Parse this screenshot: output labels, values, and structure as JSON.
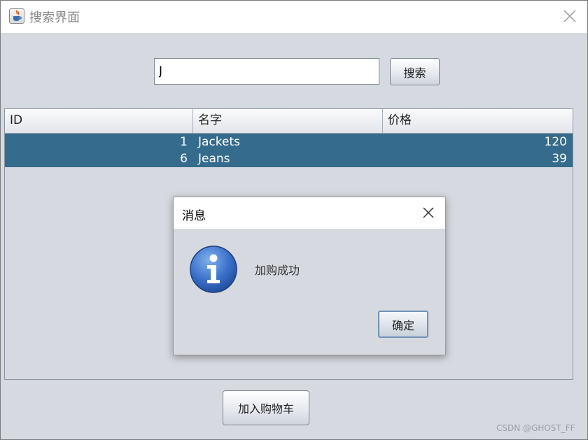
{
  "window": {
    "title": "搜索界面",
    "icons": {
      "app": "java-cup-icon",
      "close": "close-icon"
    }
  },
  "search": {
    "value": "J",
    "button_label": "搜索"
  },
  "table": {
    "columns": [
      "ID",
      "名字",
      "价格"
    ],
    "rows": [
      {
        "id": "1",
        "name": "Jackets",
        "price": "120",
        "selected": true
      },
      {
        "id": "6",
        "name": "Jeans",
        "price": "39",
        "selected": true
      }
    ],
    "selection_color": "#356b8c"
  },
  "dialog": {
    "title": "消息",
    "message": "加购成功",
    "ok_label": "确定",
    "icons": {
      "info": "info-icon",
      "close": "close-icon"
    }
  },
  "footer": {
    "cart_button_label": "加入购物车"
  },
  "watermark": "CSDN @GHOST_FF"
}
